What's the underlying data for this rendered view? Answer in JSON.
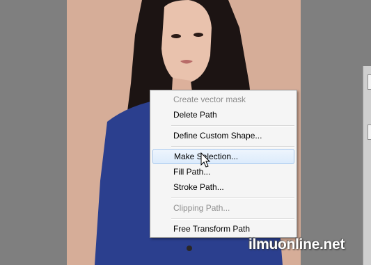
{
  "context_menu": {
    "items": [
      {
        "label": "Create vector mask",
        "enabled": false
      },
      {
        "label": "Delete Path",
        "enabled": true
      },
      {
        "label": "Define Custom Shape...",
        "enabled": true
      },
      {
        "label": "Make Selection...",
        "enabled": true,
        "highlighted": true
      },
      {
        "label": "Fill Path...",
        "enabled": true
      },
      {
        "label": "Stroke Path...",
        "enabled": true
      },
      {
        "label": "Clipping Path...",
        "enabled": false
      },
      {
        "label": "Free Transform Path",
        "enabled": true
      }
    ]
  },
  "watermark": "ilmuonline.net",
  "colors": {
    "workspace": "#808080",
    "menu_background": "#f5f5f5",
    "highlight": "#dcebfc",
    "disabled_text": "#8d8d8d",
    "photo_background": "#d5ab96",
    "sweater": "#2b3f8e"
  },
  "icons": [
    "arrow-cursor-icon"
  ]
}
